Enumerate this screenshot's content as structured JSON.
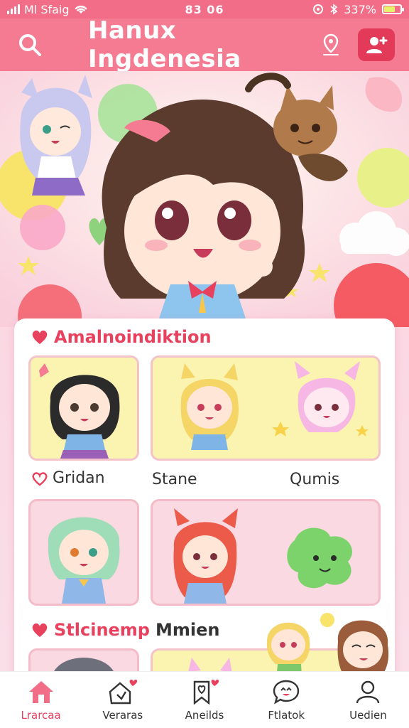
{
  "status_bar": {
    "carrier": "Ml Sfaig",
    "time": "83 06",
    "battery_text": "337%",
    "battery_level": 0.7
  },
  "header": {
    "title": "Hanux Ingdenesia"
  },
  "sections": [
    {
      "title": "Amalnoindiktion"
    },
    {
      "title": "Stlcinemp",
      "title_extra": "Mmien"
    }
  ],
  "row_labels": [
    "Gridan",
    "Stane",
    "Qumis"
  ],
  "bottom_nav": {
    "items": [
      {
        "label": "Lrarcaa",
        "icon": "home-icon"
      },
      {
        "label": "Veraras",
        "icon": "heart-house-icon"
      },
      {
        "label": "Aneilds",
        "icon": "bookmark-heart-icon"
      },
      {
        "label": "Ftlatok",
        "icon": "chat-face-icon"
      },
      {
        "label": "Uedien",
        "icon": "user-icon"
      }
    ]
  },
  "colors": {
    "accent": "#f47b91",
    "accent_dark": "#e23a58",
    "active_nav": "#e8415e",
    "tile_yellow": "#fbf3b0",
    "tile_pink": "#fbd9e2"
  }
}
